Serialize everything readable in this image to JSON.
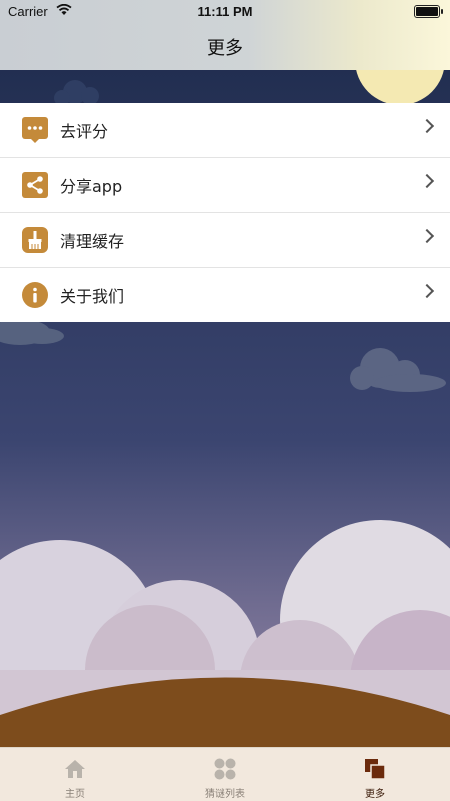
{
  "status_bar": {
    "carrier": "Carrier",
    "time": "11:11 PM"
  },
  "nav": {
    "title": "更多"
  },
  "menu": {
    "items": [
      {
        "label": "去评分",
        "icon": "comment-dots-icon"
      },
      {
        "label": "分享app",
        "icon": "share-icon"
      },
      {
        "label": "清理缓存",
        "icon": "broom-icon"
      },
      {
        "label": "关于我们",
        "icon": "info-icon"
      }
    ]
  },
  "tabs": [
    {
      "label": "主页",
      "icon": "home-icon",
      "active": false
    },
    {
      "label": "猜谜列表",
      "icon": "grid-icon",
      "active": false
    },
    {
      "label": "更多",
      "icon": "more-squares-icon",
      "active": true
    }
  ],
  "colors": {
    "accent": "#c48a3a",
    "tab_active": "#6b2a0c",
    "tab_inactive": "#b9b3ab",
    "night_sky": "#243055",
    "ground": "#7d4c1c"
  }
}
